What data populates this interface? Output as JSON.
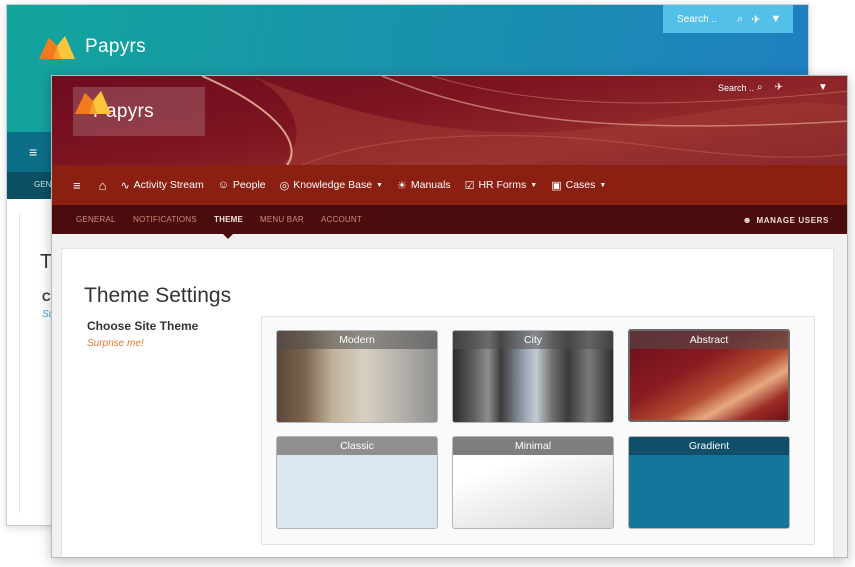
{
  "back_window": {
    "app_name": "Papyrs",
    "search_placeholder": "Search ..",
    "subnav_first": "GENERAL",
    "title_initial": "T",
    "subtitle_initial": "C",
    "link_initial": "Su"
  },
  "front_window": {
    "app_name": "Papyrs",
    "search_placeholder": "Search ..",
    "nav": [
      {
        "label": "Activity Stream",
        "icon": "activity-icon"
      },
      {
        "label": "People",
        "icon": "people-icon"
      },
      {
        "label": "Knowledge Base",
        "icon": "brain-icon",
        "dropdown": true
      },
      {
        "label": "Manuals",
        "icon": "bulb-icon"
      },
      {
        "label": "HR Forms",
        "icon": "clipboard-icon",
        "dropdown": true
      },
      {
        "label": "Cases",
        "icon": "briefcase-icon",
        "dropdown": true
      }
    ],
    "subnav": [
      {
        "label": "GENERAL",
        "active": false
      },
      {
        "label": "NOTIFICATIONS",
        "active": false
      },
      {
        "label": "THEME",
        "active": true
      },
      {
        "label": "MENU BAR",
        "active": false
      },
      {
        "label": "ACCOUNT",
        "active": false
      }
    ],
    "manage_users": "MANAGE USERS",
    "page_title": "Theme Settings",
    "choose_label": "Choose Site Theme",
    "surprise_link": "Surprise me!",
    "themes": [
      {
        "name": "Modern",
        "selected": false
      },
      {
        "name": "City",
        "selected": false
      },
      {
        "name": "Abstract",
        "selected": true
      },
      {
        "name": "Classic",
        "selected": false
      },
      {
        "name": "Minimal",
        "selected": false
      },
      {
        "name": "Gradient",
        "selected": false
      }
    ]
  },
  "colors": {
    "back_accent": "#1a8fb0",
    "front_nav": "#8a1f12",
    "front_subnav": "#4a0c0c",
    "link_orange": "#e07a2e",
    "gradient_theme": "#16759a"
  }
}
